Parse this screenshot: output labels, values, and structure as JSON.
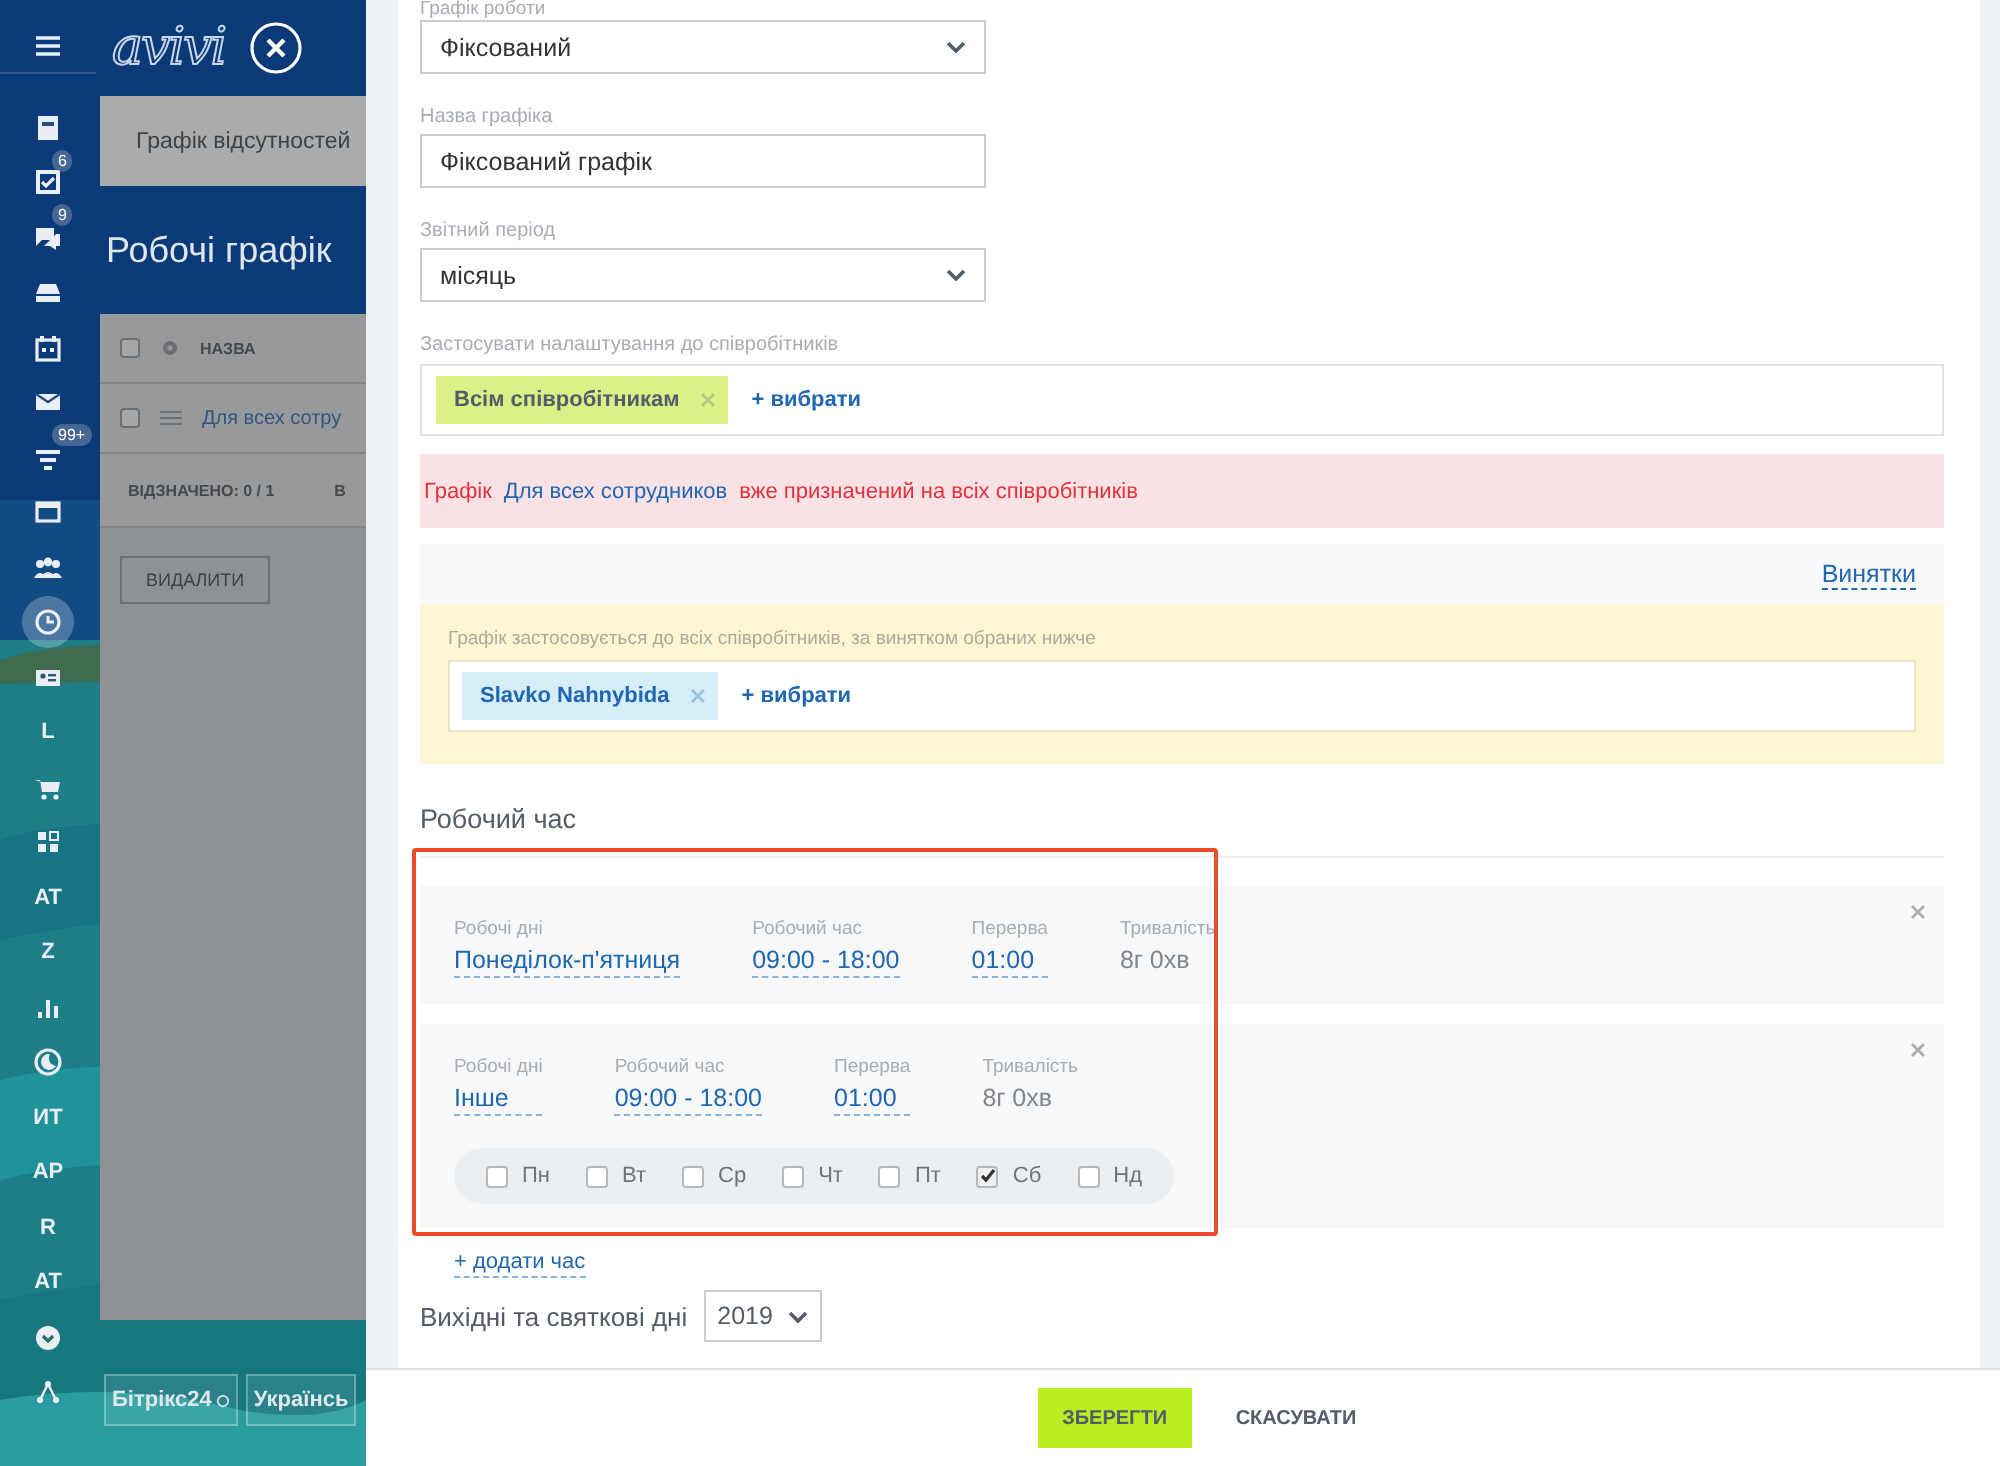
{
  "sidebar": {
    "items": [
      {
        "kind": "icon",
        "selected": false
      },
      {
        "kind": "icon",
        "selected": false
      },
      {
        "kind": "icon",
        "badge": "6",
        "selected": false
      },
      {
        "kind": "icon",
        "badge": "9",
        "selected": false
      },
      {
        "kind": "icon",
        "selected": false
      },
      {
        "kind": "icon",
        "selected": false
      },
      {
        "kind": "icon",
        "selected": false
      },
      {
        "kind": "icon",
        "badge": "99+",
        "selected": false
      },
      {
        "kind": "icon",
        "selected": false
      },
      {
        "kind": "icon",
        "selected": false
      },
      {
        "kind": "icon",
        "selected": true
      },
      {
        "kind": "icon",
        "selected": false
      },
      {
        "kind": "letter",
        "label": "L",
        "selected": false
      },
      {
        "kind": "icon",
        "selected": false
      },
      {
        "kind": "icon",
        "selected": false
      },
      {
        "kind": "letter",
        "label": "AT",
        "selected": false
      },
      {
        "kind": "letter",
        "label": "Z",
        "selected": false
      },
      {
        "kind": "icon",
        "selected": false
      },
      {
        "kind": "icon",
        "selected": false
      },
      {
        "kind": "letter",
        "label": "ИТ",
        "selected": false
      },
      {
        "kind": "letter",
        "label": "AP",
        "selected": false
      },
      {
        "kind": "letter",
        "label": "R",
        "selected": false
      },
      {
        "kind": "letter",
        "label": "AT",
        "selected": false
      },
      {
        "kind": "icon",
        "selected": false
      },
      {
        "kind": "icon",
        "selected": false
      }
    ]
  },
  "background_page": {
    "logo": "avivi",
    "tab": "Графік відсутностей",
    "title": "Робочі графік",
    "table": {
      "header": "НАЗВА",
      "header_checked": false,
      "row": "Для всех сотру",
      "row_checked": false,
      "footer_count": "ВІДЗНАЧЕНО: 0 / 1",
      "footer_cut": "В"
    },
    "delete_button": "ВИДАЛИТИ",
    "footer_buttons": [
      "Бітрікс24",
      "Українсь"
    ]
  },
  "form": {
    "schedule_type": {
      "label": "Графік роботи",
      "value": "Фіксований"
    },
    "schedule_name": {
      "label": "Назва графіка",
      "value": "Фіксований графік"
    },
    "report_period": {
      "label": "Звітний період",
      "value": "місяць"
    },
    "apply_to": {
      "label": "Застосувати налаштування до співробітників",
      "tags": [
        "Всім співробітникам"
      ],
      "add_link": "+ вибрати"
    },
    "alert": {
      "before": "Графік",
      "link": "Для всех сотрудников",
      "after": "вже призначений на всіх співробітників"
    },
    "exceptions": {
      "tab": "Винятки",
      "hint": "Графік застосовується до всіх співробітників, за винятком обраних нижче",
      "tags": [
        "Slavko Nahnybida"
      ],
      "add_link": "+ вибрати"
    },
    "work_time": {
      "title": "Робочий час",
      "shifts": [
        {
          "days_label": "Робочі дні",
          "days": "Понеділок-п'ятниця",
          "time_label": "Робочий час",
          "time": "09:00 - 18:00",
          "break_label": "Перерва",
          "break": "01:00",
          "duration_label": "Тривалість",
          "duration": "8г 0хв"
        },
        {
          "days_label": "Робочі дні",
          "days": "Інше",
          "time_label": "Робочий час",
          "time": "09:00 - 18:00",
          "break_label": "Перерва",
          "break": "01:00",
          "duration_label": "Тривалість",
          "duration": "8г 0хв",
          "weekdays": [
            {
              "label": "Пн",
              "checked": false
            },
            {
              "label": "Вт",
              "checked": false
            },
            {
              "label": "Ср",
              "checked": false
            },
            {
              "label": "Чт",
              "checked": false
            },
            {
              "label": "Пт",
              "checked": false
            },
            {
              "label": "Сб",
              "checked": true
            },
            {
              "label": "Нд",
              "checked": false
            }
          ]
        }
      ],
      "add_link": "+ додати час"
    },
    "holidays": {
      "label": "Вихідні та святкові дні",
      "year": "2019"
    }
  },
  "footer": {
    "buttons": [
      {
        "kind": "primary",
        "label": "ЗБЕРЕГТИ"
      },
      {
        "kind": "link",
        "label": "СКАСУВАТИ"
      }
    ]
  }
}
